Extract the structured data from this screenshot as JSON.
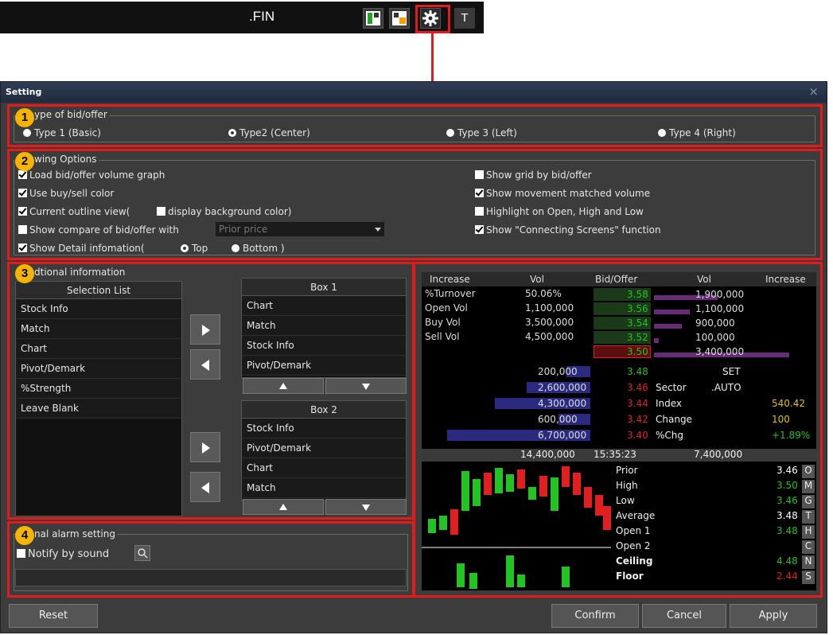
{
  "toolbar": {
    "title": ".FIN",
    "t_label": "T"
  },
  "dialog": {
    "title": "Setting",
    "close": "×"
  },
  "section1": {
    "number": "1",
    "label": "ype of bid/offer",
    "options": [
      "Type 1 (Basic)",
      "Type2 (Center)",
      "Type 3 (Left)",
      "Type 4 (Right)"
    ],
    "selected": "Type2 (Center)"
  },
  "section2": {
    "number": "2",
    "label": "wing Options",
    "left": [
      {
        "label": "Load bid/offer volume graph",
        "checked": true
      },
      {
        "label": "Use buy/sell color",
        "checked": true
      },
      {
        "label": "Current outline view(",
        "checked": true
      },
      {
        "label": "Show compare of bid/offer with",
        "checked": false
      },
      {
        "label": "Show Detail infomation(",
        "checked": true
      }
    ],
    "bg_color_label": "display background color)",
    "compare_placeholder": "Prior price",
    "top_label": "Top",
    "bottom_label": "Bottom )",
    "right": [
      {
        "label": "Show grid by bid/offer",
        "checked": false
      },
      {
        "label": "Show movement matched volume",
        "checked": true
      },
      {
        "label": "Highlight on Open, High and Low",
        "checked": false
      },
      {
        "label": "Show \"Connecting Screens\" function",
        "checked": true
      }
    ]
  },
  "section3": {
    "number": "3",
    "label": "dtional information",
    "selection_list": {
      "title": "Selection List",
      "items": [
        "Stock Info",
        "Match",
        "Chart",
        "Pivot/Demark",
        "%Strength",
        "Leave Blank"
      ]
    },
    "box1": {
      "title": "Box 1",
      "items": [
        "Chart",
        "Match",
        "Stock Info",
        "Pivot/Demark"
      ]
    },
    "box2": {
      "title": "Box 2",
      "items": [
        "Stock Info",
        "Pivot/Demark",
        "Chart",
        "Match"
      ]
    }
  },
  "preview": {
    "headers": [
      "Increase",
      "Vol",
      "Bid/Offer",
      "Vol",
      "Increase"
    ],
    "left_stats": [
      {
        "label": "%Turnover",
        "value": "50.06%"
      },
      {
        "label": "Open Vol",
        "value": "1,100,000"
      },
      {
        "label": "Buy Vol",
        "value": "3,500,000"
      },
      {
        "label": "Sell Vol",
        "value": "4,500,000"
      }
    ],
    "offers": [
      {
        "price": "3.58",
        "vol": "1,900,000"
      },
      {
        "price": "3.56",
        "vol": "1,100,000"
      },
      {
        "price": "3.54",
        "vol": "900,000"
      },
      {
        "price": "3.52",
        "vol": "100,000"
      },
      {
        "price": "3.50",
        "vol": "3,400,000"
      }
    ],
    "bids": [
      {
        "vol": "200,000",
        "price": "3.48"
      },
      {
        "vol": "2,600,000",
        "price": "3.46"
      },
      {
        "vol": "4,300,000",
        "price": "3.44"
      },
      {
        "vol": "600,000",
        "price": "3.42"
      },
      {
        "vol": "6,700,000",
        "price": "3.40"
      }
    ],
    "right_info": [
      {
        "label": "SET",
        "value": ""
      },
      {
        "label": "Sector",
        "value": ".AUTO"
      },
      {
        "label": "Index",
        "value": "540.42"
      },
      {
        "label": "Change",
        "value": "100"
      },
      {
        "label": "%Chg",
        "value": "+1.89%"
      }
    ],
    "totals": {
      "bid_vol": "14,400,000",
      "time": "15:35:23",
      "offer_vol": "7,400,000"
    },
    "price_info": [
      {
        "label": "Prior",
        "value": "3.46",
        "key": "O"
      },
      {
        "label": "High",
        "value": "3.50",
        "key": "M"
      },
      {
        "label": "Low",
        "value": "3.46",
        "key": "G"
      },
      {
        "label": "Average",
        "value": "3.48",
        "key": "T"
      },
      {
        "label": "Open 1",
        "value": "3.48",
        "key": "H"
      },
      {
        "label": "Open 2",
        "value": "",
        "key": "C"
      },
      {
        "label": "Ceiling",
        "value": "4.48",
        "key": "N"
      },
      {
        "label": "Floor",
        "value": "2.44",
        "key": "S"
      }
    ]
  },
  "section4": {
    "number": "4",
    "label": "nal alarm setting",
    "notify_label": "Notify by sound",
    "notify_checked": false
  },
  "buttons": {
    "reset": "Reset",
    "confirm": "Confirm",
    "cancel": "Cancel",
    "apply": "Apply"
  },
  "colors": {
    "accent_red": "#e51a1a",
    "badge": "#f5b400",
    "up_green": "#22c322",
    "down_red": "#e02020",
    "bar_purple": "#6a2a7a",
    "bar_blue": "#2a2a80"
  }
}
